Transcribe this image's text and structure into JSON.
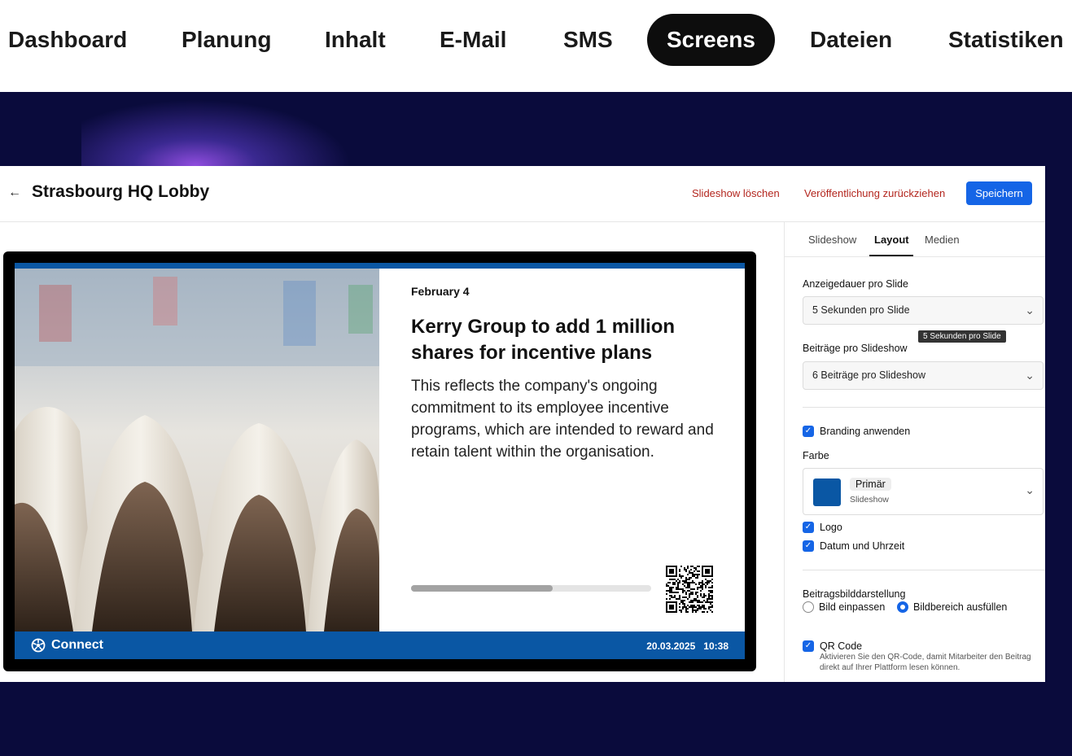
{
  "nav": {
    "items": [
      "Dashboard",
      "Planung",
      "Inhalt",
      "E-Mail",
      "SMS",
      "Screens",
      "Dateien",
      "Statistiken"
    ],
    "active": "Screens"
  },
  "header": {
    "back_icon": "arrow-left-icon",
    "title": "Strasbourg HQ Lobby",
    "delete_label": "Slideshow löschen",
    "unpublish_label": "Veröffentlichung zurückziehen",
    "save_label": "Speichern"
  },
  "preview": {
    "date": "February 4",
    "headline": "Kerry Group to add 1 million shares for incentive plans",
    "body": "This reflects the company's ongoing commitment to its employee incentive programs, which are intended to reward and retain talent within the organisation.",
    "progress": 0.59,
    "footer_logo": "Connect",
    "footer_date": "20.03.2025",
    "footer_time": "10:38",
    "brand_color": "#0a57a4"
  },
  "sidebar": {
    "tabs": [
      "Slideshow",
      "Layout",
      "Medien"
    ],
    "active_tab": "Layout",
    "duration_label": "Anzeigedauer pro Slide",
    "duration_value": "5 Sekunden pro Slide",
    "tooltip": "5 Sekunden pro Slide",
    "posts_label": "Beiträge pro Slideshow",
    "posts_value": "6 Beiträge pro Slideshow",
    "branding_label": "Branding anwenden",
    "color_label": "Farbe",
    "color_chip": "Primär",
    "color_sub": "Slideshow",
    "logo_label": "Logo",
    "datetime_label": "Datum und Uhrzeit",
    "image_display_label": "Beitragsbilddarstellung",
    "fit_label": "Bild einpassen",
    "fill_label": "Bildbereich ausfüllen",
    "qr_label": "QR Code",
    "qr_hint": "Aktivieren Sie den QR-Code, damit Mitarbeiter den Beitrag direkt auf Ihrer Plattform lesen können."
  }
}
